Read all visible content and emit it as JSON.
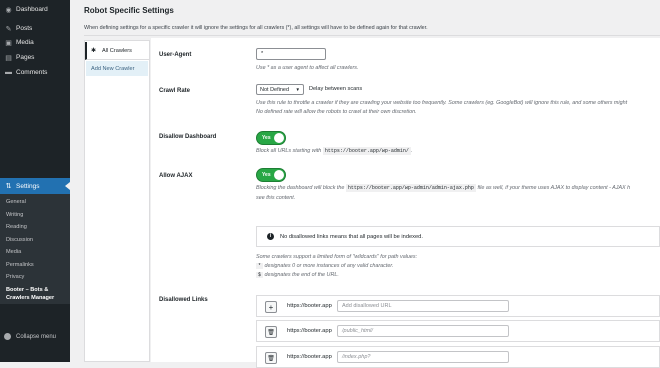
{
  "sidebar": {
    "items": [
      {
        "label": "Dashboard",
        "icon": "dashboard-icon",
        "glyph": "◉"
      },
      {
        "label": "Posts",
        "icon": "pin-icon",
        "glyph": "✎"
      },
      {
        "label": "Media",
        "icon": "media-icon",
        "glyph": "▣"
      },
      {
        "label": "Pages",
        "icon": "pages-icon",
        "glyph": "▤"
      },
      {
        "label": "Comments",
        "icon": "comments-icon",
        "glyph": "▬"
      }
    ],
    "settings": {
      "label": "Settings",
      "icon": "settings-icon",
      "glyph": "⇅"
    },
    "submenu": [
      "General",
      "Writing",
      "Reading",
      "Discussion",
      "Media",
      "Permalinks",
      "Privacy"
    ],
    "active_sub_line1": "Booter – Bots &",
    "active_sub_line2": "Crawlers Manager",
    "collapse": "Collapse menu"
  },
  "page": {
    "title": "Robot Specific Settings",
    "description": "When defining settings for a specific crawler it will ignore the settings for all crawlers (*), all settings will have to be defined again for that crawler."
  },
  "tabs": {
    "all_crawlers": "All Crawlers",
    "add_new": "Add New Crawler"
  },
  "form": {
    "user_agent": {
      "label": "User-Agent",
      "value": "*",
      "hint": "Use * as a user agent to affect all crawlers."
    },
    "crawl_rate": {
      "label": "Crawl Rate",
      "selected": "Not Defined",
      "after": "Delay between scans",
      "hint1": "Use this rule to throttle a crawler if they are crawling your website too frequently. Some crawlers (eg. GoogleBot) will ignore this rule, and some others might",
      "hint2": "No defined rate will allow the robots to crawl at their own discretion."
    },
    "disallow_dashboard": {
      "label": "Disallow Dashboard",
      "toggle": "Yes",
      "hint_pre": "Block all URLs starting with",
      "code": "https://booter.app/wp-admin/",
      "hint_post": "."
    },
    "allow_ajax": {
      "label": "Allow AJAX",
      "toggle": "Yes",
      "hint_pre": "Blocking the dashboard will block the",
      "code": "https://booter.app/wp-admin/admin-ajax.php",
      "hint_post": "file as well, if your theme uses AJAX to display content - AJAX h",
      "hint2": "see this content."
    },
    "notice": "No disallowed links means that all pages will be indexed.",
    "wildcards": {
      "line1": "Some crawlers support a limited form of \"wildcards\" for path values:",
      "star": "*",
      "line2": "designates 0 or more instances of any valid character.",
      "dollar": "$",
      "line3": "designates the end of the URL."
    },
    "disallowed_links": {
      "label": "Disallowed Links",
      "rows": [
        {
          "button": "+",
          "button_icon": "plus-icon",
          "domain": "https://booter.app",
          "placeholder": "Add disallowed URL"
        },
        {
          "button": "🗑",
          "button_icon": "trash-icon",
          "domain": "https://booter.app",
          "placeholder": "/public_html/"
        },
        {
          "button": "🗑",
          "button_icon": "trash-icon",
          "domain": "https://booter.app",
          "placeholder": "/index.php?"
        }
      ]
    }
  },
  "colors": {
    "sidebar": "#1d2327",
    "accent": "#2271b1",
    "toggle_on": "#28a745"
  }
}
